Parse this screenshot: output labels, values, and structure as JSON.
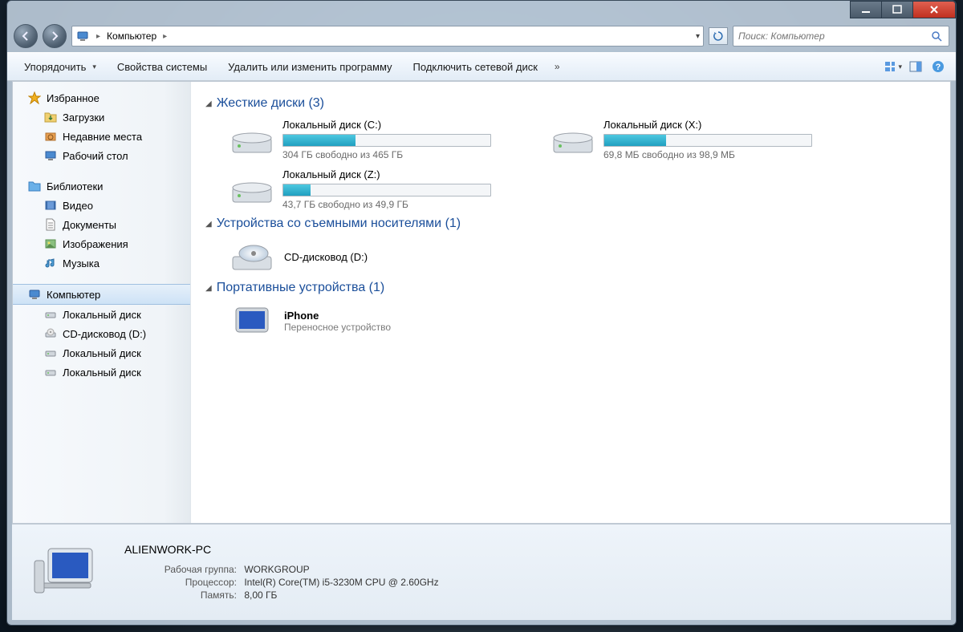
{
  "window": {
    "location_label": "Компьютер"
  },
  "search": {
    "placeholder": "Поиск: Компьютер"
  },
  "toolbar": {
    "organize": "Упорядочить",
    "properties": "Свойства системы",
    "uninstall": "Удалить или изменить программу",
    "map_drive": "Подключить сетевой диск"
  },
  "sidebar": {
    "favorites": {
      "label": "Избранное"
    },
    "downloads": {
      "label": "Загрузки"
    },
    "recent": {
      "label": "Недавние места"
    },
    "desktop": {
      "label": "Рабочий стол"
    },
    "libraries": {
      "label": "Библиотеки"
    },
    "videos": {
      "label": "Видео"
    },
    "documents": {
      "label": "Документы"
    },
    "pictures": {
      "label": "Изображения"
    },
    "music": {
      "label": "Музыка"
    },
    "computer": {
      "label": "Компьютер"
    },
    "local_c": {
      "label": "Локальный диск"
    },
    "cd_d": {
      "label": "CD-дисковод (D:)"
    },
    "local_2": {
      "label": "Локальный диск"
    },
    "local_3": {
      "label": "Локальный диск"
    }
  },
  "sections": {
    "hdd": {
      "title": "Жесткие диски (3)"
    },
    "removable": {
      "title": "Устройства со съемными носителями (1)"
    },
    "portable": {
      "title": "Портативные устройства (1)"
    }
  },
  "drives": {
    "c": {
      "label": "Локальный диск (C:)",
      "status": "304 ГБ свободно из 465 ГБ",
      "fill_pct": 35
    },
    "x": {
      "label": "Локальный диск (X:)",
      "status": "69,8 МБ свободно из 98,9 МБ",
      "fill_pct": 30
    },
    "z": {
      "label": "Локальный диск (Z:)",
      "status": "43,7 ГБ свободно из 49,9 ГБ",
      "fill_pct": 13
    }
  },
  "cd": {
    "label": "CD-дисковод (D:)"
  },
  "iphone": {
    "label": "iPhone",
    "sub": "Переносное устройство"
  },
  "details": {
    "pc_name": "ALIENWORK-PC",
    "workgroup_lbl": "Рабочая группа:",
    "workgroup_val": "WORKGROUP",
    "cpu_lbl": "Процессор:",
    "cpu_val": "Intel(R) Core(TM) i5-3230M CPU @ 2.60GHz",
    "ram_lbl": "Память:",
    "ram_val": "8,00 ГБ"
  }
}
